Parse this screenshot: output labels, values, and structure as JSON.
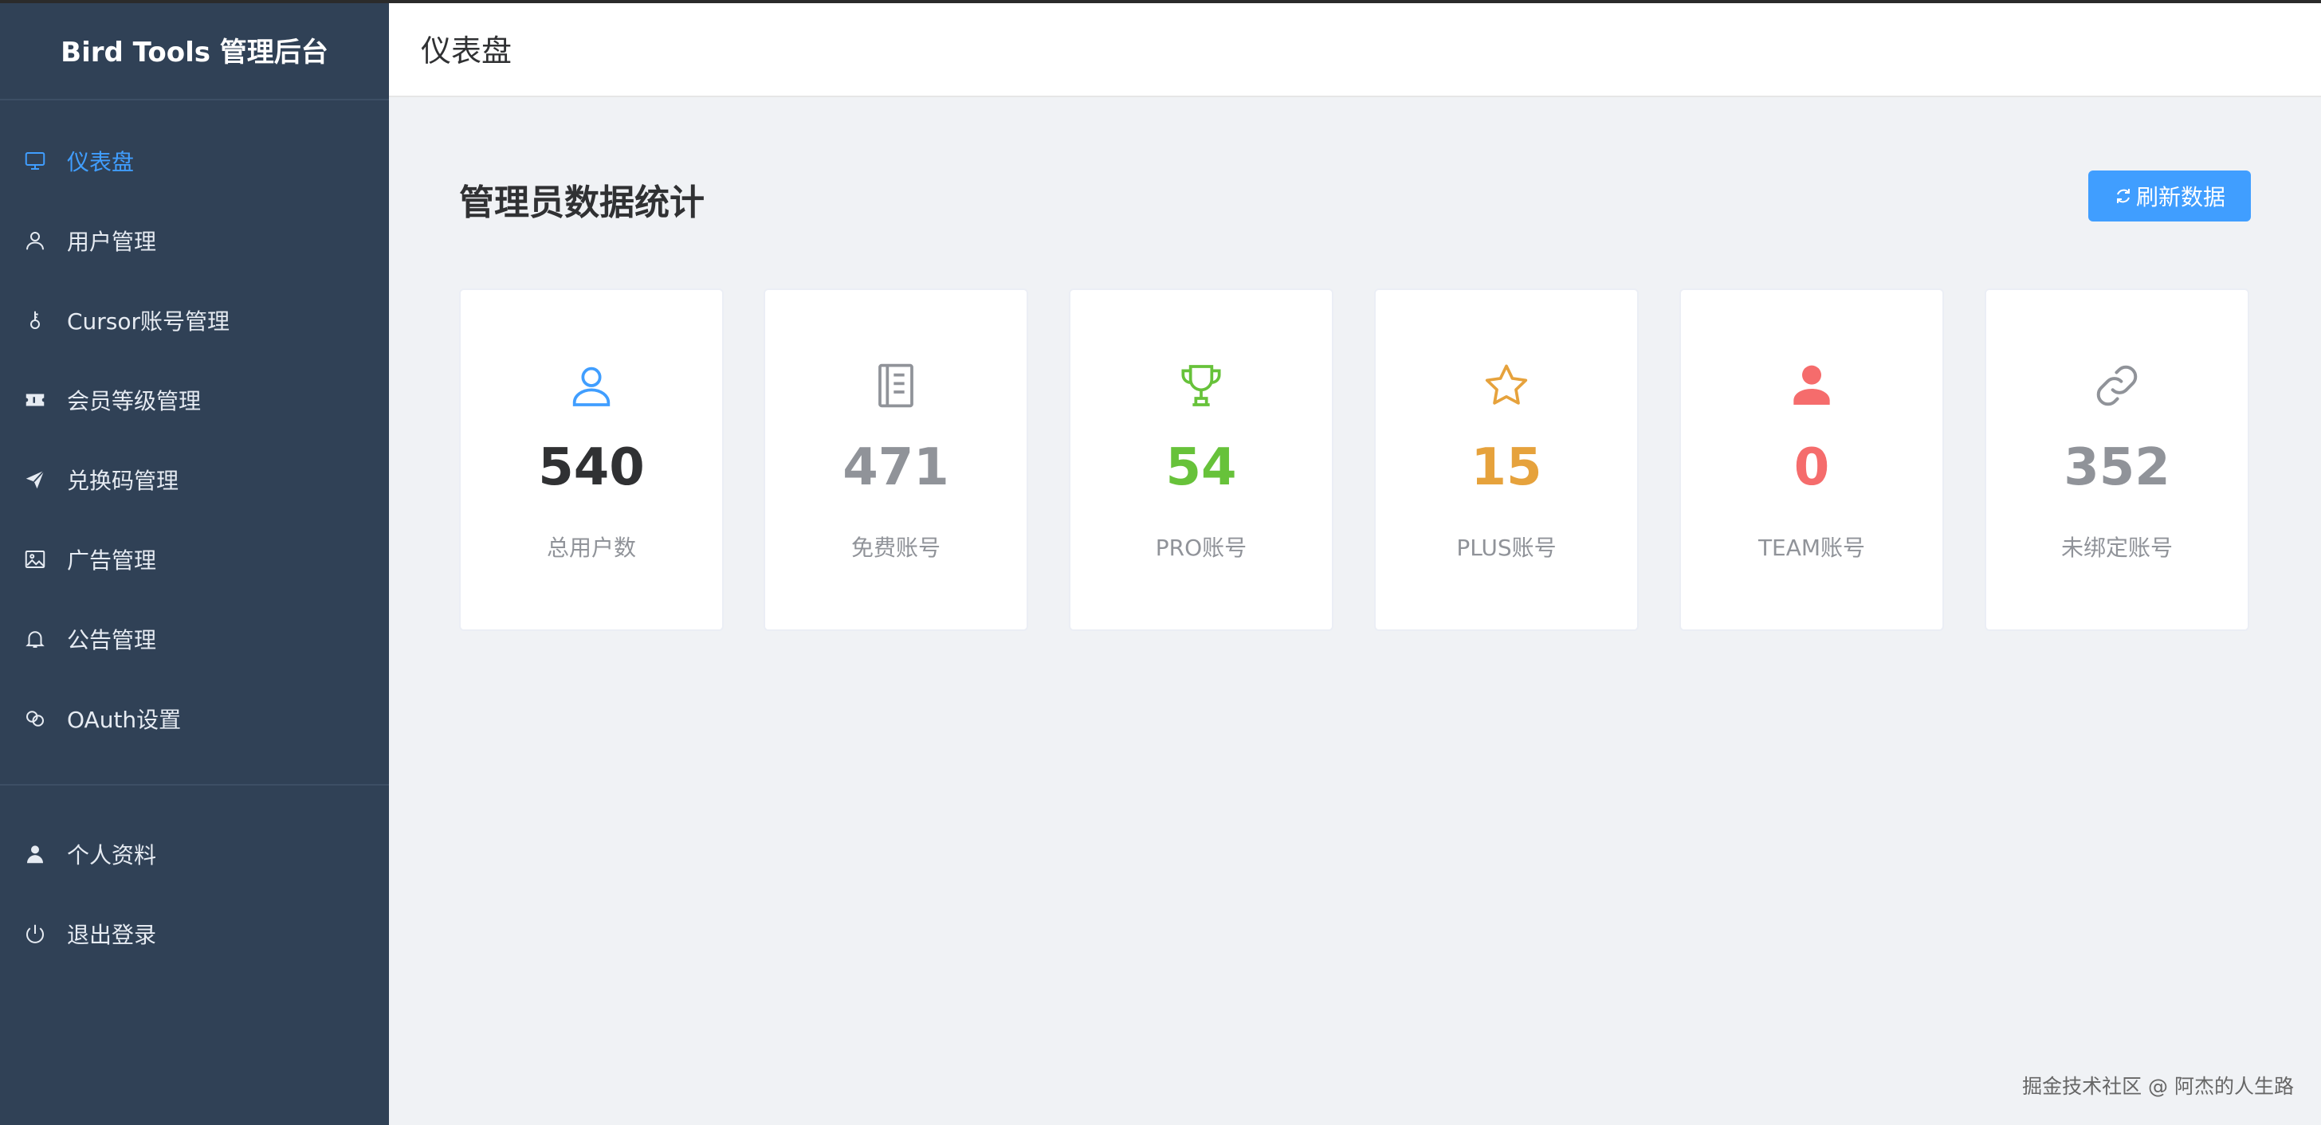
{
  "sidebar": {
    "brand": "Bird Tools 管理后台",
    "items": [
      {
        "label": "仪表盘",
        "icon": "monitor-icon",
        "active": true
      },
      {
        "label": "用户管理",
        "icon": "user-icon"
      },
      {
        "label": "Cursor账号管理",
        "icon": "key-icon"
      },
      {
        "label": "会员等级管理",
        "icon": "ticket-icon"
      },
      {
        "label": "兑换码管理",
        "icon": "send-icon"
      },
      {
        "label": "广告管理",
        "icon": "image-icon"
      },
      {
        "label": "公告管理",
        "icon": "bell-icon"
      },
      {
        "label": "OAuth设置",
        "icon": "link-circles-icon"
      }
    ],
    "bottom_items": [
      {
        "label": "个人资料",
        "icon": "user-solid-icon"
      },
      {
        "label": "退出登录",
        "icon": "power-icon"
      }
    ]
  },
  "header": {
    "title": "仪表盘"
  },
  "main": {
    "section_title": "管理员数据统计",
    "refresh_label": "刷新数据",
    "stats": [
      {
        "value": "540",
        "label": "总用户数",
        "icon": "user-outline-icon",
        "color": "#303133",
        "icon_color": "#409eff"
      },
      {
        "value": "471",
        "label": "免费账号",
        "icon": "notebook-icon",
        "color": "#909399",
        "icon_color": "#909399"
      },
      {
        "value": "54",
        "label": "PRO账号",
        "icon": "trophy-icon",
        "color": "#67c23a",
        "icon_color": "#67c23a"
      },
      {
        "value": "15",
        "label": "PLUS账号",
        "icon": "star-icon",
        "color": "#e6a23c",
        "icon_color": "#e6a23c"
      },
      {
        "value": "0",
        "label": "TEAM账号",
        "icon": "user-solid-icon",
        "color": "#f56c6c",
        "icon_color": "#f56c6c"
      },
      {
        "value": "352",
        "label": "未绑定账号",
        "icon": "link-icon",
        "color": "#909399",
        "icon_color": "#909399"
      }
    ]
  },
  "watermark": "掘金技术社区 @ 阿杰的人生路",
  "colors": {
    "sidebar_bg": "#304156",
    "accent": "#409eff",
    "page_bg": "#f0f2f5"
  }
}
